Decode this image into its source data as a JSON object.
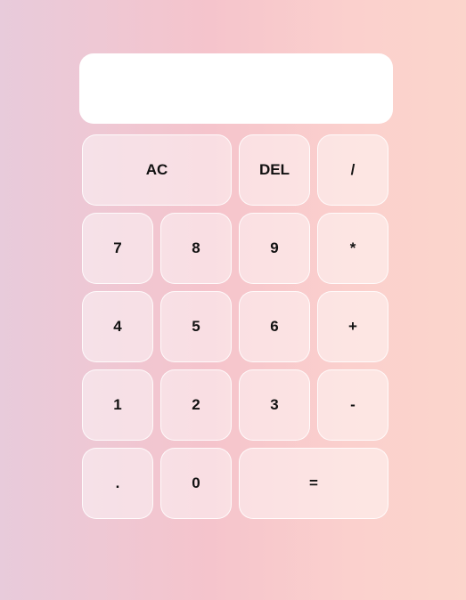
{
  "display": {
    "value": ""
  },
  "keys": {
    "clear": "AC",
    "delete": "DEL",
    "divide": "/",
    "seven": "7",
    "eight": "8",
    "nine": "9",
    "multiply": "*",
    "four": "4",
    "five": "5",
    "six": "6",
    "plus": "+",
    "one": "1",
    "two": "2",
    "three": "3",
    "minus": "-",
    "decimal": ".",
    "zero": "0",
    "equals": "="
  },
  "colors": {
    "background_start": "#e8cbdb",
    "background_end": "#fbd5cc",
    "display_bg": "#ffffff",
    "key_bg": "#f8e2e5"
  }
}
